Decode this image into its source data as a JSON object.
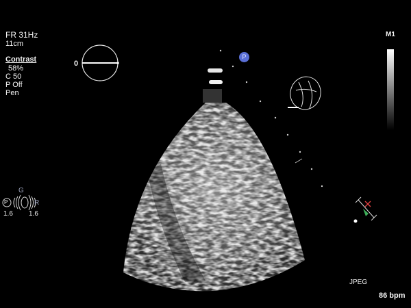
{
  "params": {
    "frame_rate": "FR 31Hz",
    "depth": "11cm",
    "mode": "Contrast",
    "gain_pct": "58%",
    "compression": "C 50",
    "persistence": "P Off",
    "preset": "Pen"
  },
  "angle_indicator": {
    "value": "0"
  },
  "marker": {
    "label": "P"
  },
  "grayscale": {
    "label": "M1"
  },
  "probe_status": {
    "g_label": "G",
    "p_label": "P",
    "r_label": "R",
    "left_value": "1.6",
    "right_value": "1.6"
  },
  "footer": {
    "format": "JPEG",
    "heart_rate": "86 bpm"
  },
  "colors": {
    "marker_blue": "#5a6fd6",
    "ecg_green": "#3fae5a",
    "ecg_red": "#e04040"
  }
}
